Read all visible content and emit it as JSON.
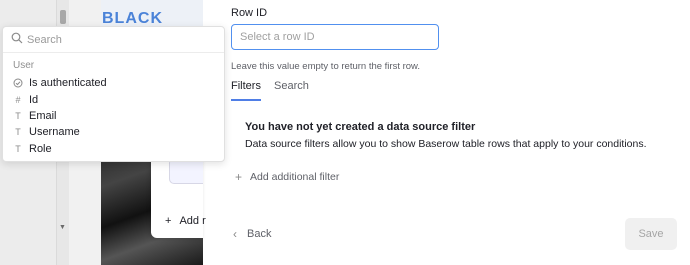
{
  "background": {
    "photo_caption": "BLACK",
    "card_add_label": "Add r"
  },
  "dropdown": {
    "search_placeholder": "Search",
    "group_label": "User",
    "items": [
      {
        "label": "Is authenticated",
        "icon": "check-circle-icon"
      },
      {
        "label": "Id",
        "icon": "hash-icon"
      },
      {
        "label": "Email",
        "icon": "text-icon"
      },
      {
        "label": "Username",
        "icon": "text-icon"
      },
      {
        "label": "Role",
        "icon": "text-icon"
      }
    ]
  },
  "form": {
    "row_id_label": "Row ID",
    "row_id_placeholder": "Select a row ID",
    "row_id_value": "",
    "help_text": "Leave this value empty to return the first row."
  },
  "tabs": [
    {
      "label": "Filters",
      "active": true
    },
    {
      "label": "Search",
      "active": false
    }
  ],
  "empty_state": {
    "title": "You have not yet created a data source filter",
    "description": "Data source filters allow you to show Baserow table rows that apply to your conditions."
  },
  "actions": {
    "add_filter_label": "Add additional filter",
    "back_label": "Back",
    "save_label": "Save"
  },
  "colors": {
    "accent": "#5190ef",
    "tab_underline": "#4f7ee6"
  }
}
